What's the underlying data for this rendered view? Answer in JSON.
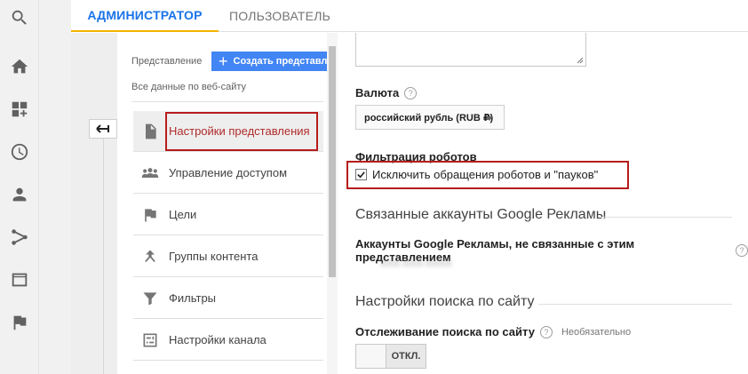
{
  "tabs": {
    "admin": "АДМИНИСТРАТОР",
    "user": "ПОЛЬЗОВАТЕЛЬ"
  },
  "rail_icons": [
    "search-icon",
    "home-icon",
    "dashboard-add-icon",
    "clock-icon",
    "person-icon",
    "share-nodes-icon",
    "window-icon",
    "flag-icon"
  ],
  "view": {
    "label": "Представление",
    "create_button": "Создать представление",
    "selected": "Все данные по веб-сайту"
  },
  "menu": [
    {
      "label": "Настройки представления",
      "icon": "document-icon",
      "active": true
    },
    {
      "label": "Управление доступом",
      "icon": "people-icon",
      "active": false
    },
    {
      "label": "Цели",
      "icon": "flag-icon",
      "active": false
    },
    {
      "label": "Группы контента",
      "icon": "arrow-up-branch-icon",
      "active": false
    },
    {
      "label": "Фильтры",
      "icon": "filter-icon",
      "active": false
    },
    {
      "label": "Настройки канала",
      "icon": "channel-settings-icon",
      "active": false
    }
  ],
  "settings": {
    "currency_label": "Валюта",
    "currency_value": "российский рубль (RUB ₽)",
    "bot_filter_label": "Фильтрация роботов",
    "bot_filter_checkbox": "Исключить обращения роботов и \"пауков\"",
    "bot_filter_checked": true,
    "ads_section_title": "Связанные аккаунты Google Рекламы",
    "ads_unlinked_label": "Аккаунты Google Рекламы, не связанные с этим представлением",
    "ads_account_id": "XXX-XXX-XXXX",
    "site_search_title": "Настройки поиска по сайту",
    "site_search_tracking_label": "Отслеживание поиска по сайту",
    "optional": "Необязательно",
    "toggle_state": "ОТКЛ.",
    "help_glyph": "?"
  },
  "colors": {
    "accent_blue": "#1a73e8",
    "button_blue": "#4285f4",
    "tab_underline": "#f4b400",
    "highlight_red": "#b71c1c"
  }
}
